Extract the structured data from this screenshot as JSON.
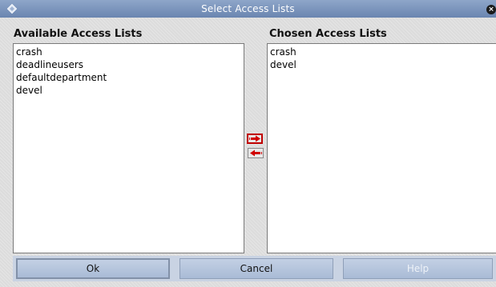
{
  "window": {
    "title": "Select Access Lists",
    "title_icon": "diamond-icon",
    "close_icon": "close-icon",
    "close_glyph": "×"
  },
  "available": {
    "label": "Available Access Lists",
    "items": [
      "crash",
      "deadlineusers",
      "defaultdepartment",
      "devel"
    ]
  },
  "chosen": {
    "label": "Chosen Access Lists",
    "items": [
      "crash",
      "devel"
    ]
  },
  "transfer": {
    "add_icon": "arrow-right-icon",
    "remove_icon": "arrow-left-icon"
  },
  "buttons": {
    "ok": "Ok",
    "cancel": "Cancel",
    "help": "Help"
  },
  "colors": {
    "titlebar": "#7a94bc",
    "arrow": "#d00000",
    "button": "#b6c6dd"
  }
}
